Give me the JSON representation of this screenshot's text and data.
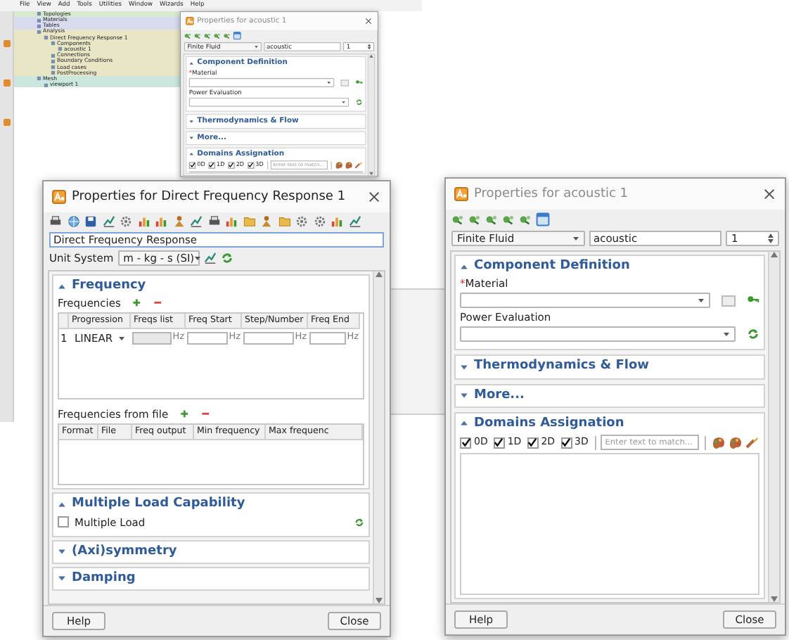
{
  "app": {
    "menu": [
      "File",
      "View",
      "Add",
      "Tools",
      "Utilities",
      "Window",
      "Wizards",
      "Help"
    ],
    "tree": [
      {
        "label": "Topologies",
        "color": "#d7e9cf"
      },
      {
        "label": "Materials",
        "color": "#d9dcee"
      },
      {
        "label": "Tables",
        "color": "#d9dcee"
      },
      {
        "label": "Analysis",
        "color": "#e9e6c6",
        "children": [
          {
            "label": "Direct Frequency Response 1",
            "children": [
              {
                "label": "Components",
                "children": [
                  {
                    "label": "acoustic 1"
                  }
                ]
              },
              {
                "label": "Connections"
              },
              {
                "label": "Boundary Conditions"
              },
              {
                "label": "Load cases"
              },
              {
                "label": "PostProcessing"
              }
            ]
          }
        ]
      },
      {
        "label": "Mesh",
        "color": "#cbe7de",
        "children": [
          {
            "label": "viewport 1"
          }
        ]
      }
    ]
  },
  "background_dialog": {
    "title": "Properties for acoustic 1",
    "active": false,
    "type_select": "Finite Fluid",
    "name": "acoustic",
    "index": "1",
    "sections": [
      {
        "kind": "component",
        "title": "Component Definition",
        "expanded": true,
        "fields": [
          {
            "label": "Material",
            "required_mark": "*",
            "browse_button": true
          },
          {
            "label": "Power Evaluation",
            "browse_button": false
          }
        ]
      },
      {
        "kind": "plain",
        "title": "Thermodynamics & Flow",
        "expanded": false
      },
      {
        "kind": "plain",
        "title": "More...",
        "expanded": false
      },
      {
        "kind": "domains",
        "title": "Domains Assignation",
        "expanded": true,
        "filters": [
          {
            "label": "0D",
            "checked": true
          },
          {
            "label": "1D",
            "checked": true
          },
          {
            "label": "2D",
            "checked": true
          },
          {
            "label": "3D",
            "checked": true
          }
        ],
        "search_placeholder": "Enter text to match..."
      }
    ]
  },
  "frequency_dialog": {
    "title": "Properties for Direct Frequency Response 1",
    "active": true,
    "name": "Direct Frequency Response",
    "unit_label": "Unit System",
    "unit_value": "m - kg - s (SI)",
    "sections": [
      {
        "kind": "frequency",
        "title": "Frequency",
        "expanded": true,
        "frequencies_label": "Frequencies",
        "columns": [
          "Progression",
          "Freqs list",
          "Freq Start",
          "Step/Number",
          "Freq End"
        ],
        "rows": [
          {
            "number": "1",
            "cells": [
              {
                "kind": "dropdown",
                "value": "LINEAR"
              },
              {
                "kind": "input",
                "unit": "Hz",
                "disabled": true
              },
              {
                "kind": "input",
                "unit": "Hz",
                "disabled": false
              },
              {
                "kind": "input",
                "unit": "Hz",
                "disabled": false
              },
              {
                "kind": "input",
                "unit": "Hz",
                "disabled": false
              }
            ]
          }
        ],
        "file_label": "Frequencies from file",
        "file_columns": [
          "Format",
          "File",
          "Freq output",
          "Min frequency",
          "Max frequenc"
        ]
      },
      {
        "kind": "checks",
        "title": "Multiple Load Capability",
        "expanded": true,
        "options": [
          {
            "label": "Multiple Load",
            "checked": false
          }
        ]
      },
      {
        "kind": "plain",
        "title": "(Axi)symmetry",
        "expanded": false
      },
      {
        "kind": "plain",
        "title": "Damping",
        "expanded": false
      }
    ],
    "buttons": [
      "Help",
      "Close"
    ]
  },
  "acoustic_dialog": {
    "title": "Properties for acoustic 1",
    "active": false,
    "type_select": "Finite Fluid",
    "name": "acoustic",
    "index": "1",
    "sections": [
      {
        "kind": "component",
        "title": "Component Definition",
        "expanded": true,
        "fields": [
          {
            "label": "Material",
            "required_mark": "*",
            "browse_button": true
          },
          {
            "label": "Power Evaluation",
            "browse_button": false
          }
        ]
      },
      {
        "kind": "plain",
        "title": "Thermodynamics & Flow",
        "expanded": false
      },
      {
        "kind": "plain",
        "title": "More...",
        "expanded": false
      },
      {
        "kind": "domains",
        "title": "Domains Assignation",
        "expanded": true,
        "filters": [
          {
            "label": "0D",
            "checked": true
          },
          {
            "label": "1D",
            "checked": true
          },
          {
            "label": "2D",
            "checked": true
          },
          {
            "label": "3D",
            "checked": true
          }
        ],
        "search_placeholder": "Enter text to match..."
      }
    ],
    "buttons": [
      "Help",
      "Close"
    ]
  }
}
